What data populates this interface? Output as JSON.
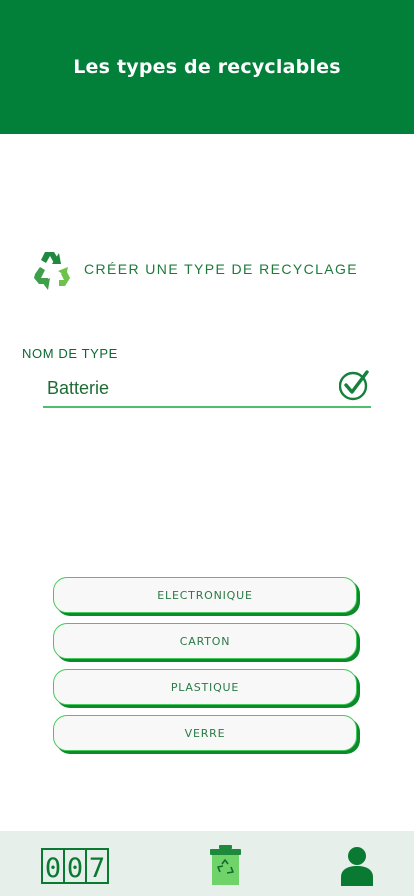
{
  "header": {
    "title": "Les types de recyclables"
  },
  "create": {
    "label": "CRÉER UNE TYPE DE RECYCLAGE",
    "icon": "recycle-icon"
  },
  "form": {
    "field_label": "NOM DE TYPE",
    "field_value": "Batterie",
    "confirm_icon": "check-circle-icon"
  },
  "types": {
    "items": [
      {
        "label": "ELECTRONIQUE"
      },
      {
        "label": "CARTON"
      },
      {
        "label": "PLASTIQUE"
      },
      {
        "label": "VERRE"
      }
    ]
  },
  "nav": {
    "counter": {
      "digits": [
        "0",
        "0",
        "7"
      ],
      "icon": "counter-icon"
    },
    "bin": {
      "icon": "recycle-bin-icon"
    },
    "user": {
      "icon": "user-icon"
    }
  },
  "colors": {
    "primary": "#02803a",
    "accent": "#48c95b",
    "nav_bg": "#e6efea"
  }
}
